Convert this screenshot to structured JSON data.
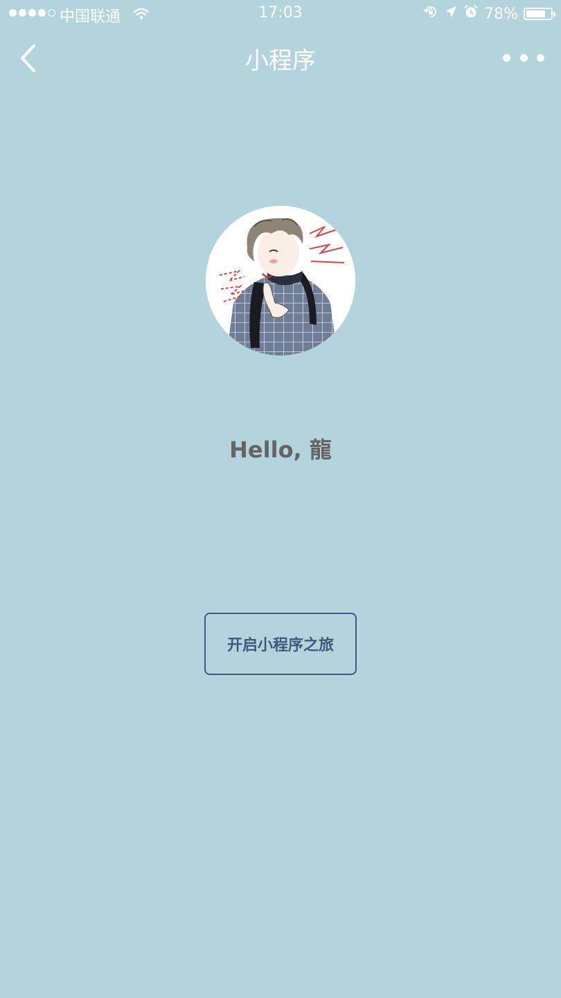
{
  "status_bar": {
    "carrier": "中国联通",
    "time": "17:03",
    "battery_percent": "78%",
    "battery_level": 0.78,
    "signal_bars_filled": 4,
    "signal_bars_total": 5,
    "icons": [
      "wifi-icon",
      "orientation-lock-icon",
      "location-arrow-icon",
      "alarm-icon",
      "battery-icon"
    ]
  },
  "nav": {
    "title": "小程序",
    "back_icon": "chevron-left-icon",
    "more_icon": "more-dots-icon"
  },
  "main": {
    "avatar_alt": "avatar",
    "greeting": "Hello, 龍",
    "start_button_label": "开启小程序之旅"
  },
  "colors": {
    "background": "#b3d4dc",
    "greeting_text": "#646464",
    "button_border": "#3d5a7e",
    "button_text": "#3d5a7e"
  }
}
